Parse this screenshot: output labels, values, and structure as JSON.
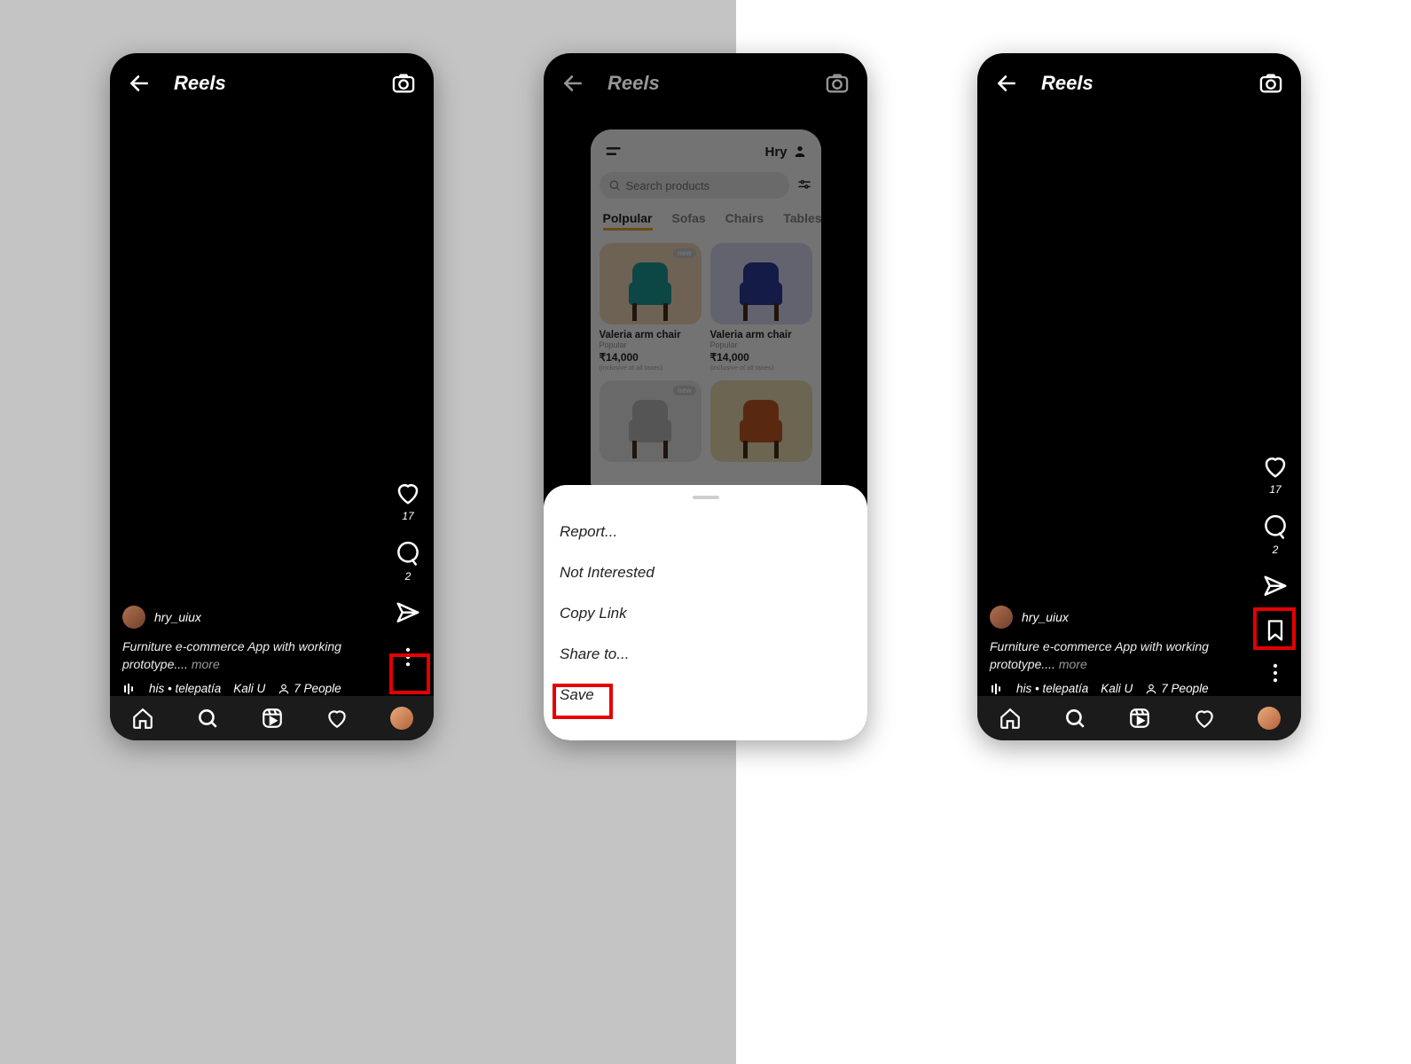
{
  "header": {
    "title": "Reels"
  },
  "actions": {
    "like_count": "17",
    "comment_count": "2"
  },
  "post": {
    "username": "hry_uiux",
    "caption_part1": "Furniture e-commerce App with working prototype....",
    "more": " more",
    "audio": "his • telepatía",
    "artist": "Kali U",
    "people": "7 People"
  },
  "sheet": {
    "report": "Report...",
    "not_interested": "Not Interested",
    "copy_link": "Copy Link",
    "share_to": "Share to...",
    "save": "Save"
  },
  "product": {
    "user": "Hry",
    "search_placeholder": "Search products",
    "tabs": {
      "popular": "Polpular",
      "sofas": "Sofas",
      "chairs": "Chairs",
      "tables": "Tables"
    },
    "badge": "new",
    "card": {
      "name": "Valeria arm chair",
      "category": "Popular",
      "price": "₹14,000",
      "tax": "(inclusive of all taxes)"
    }
  }
}
